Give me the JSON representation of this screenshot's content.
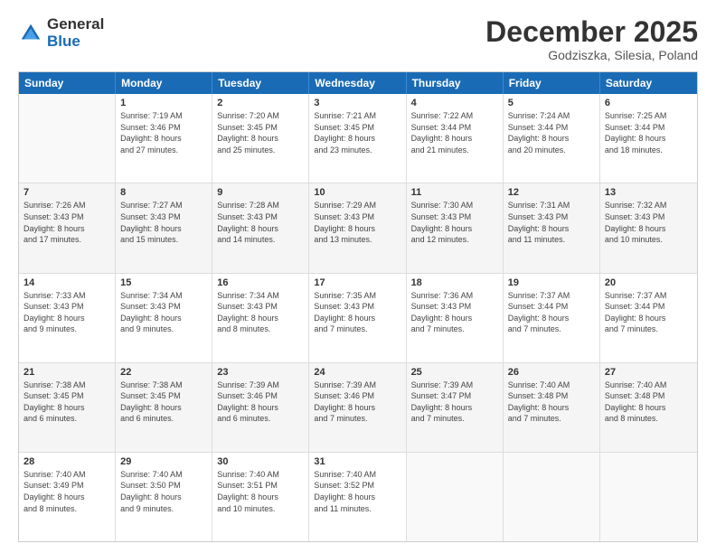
{
  "logo": {
    "general": "General",
    "blue": "Blue"
  },
  "header": {
    "month": "December 2025",
    "location": "Godziszka, Silesia, Poland"
  },
  "weekdays": [
    "Sunday",
    "Monday",
    "Tuesday",
    "Wednesday",
    "Thursday",
    "Friday",
    "Saturday"
  ],
  "rows": [
    [
      {
        "day": "",
        "info": ""
      },
      {
        "day": "1",
        "info": "Sunrise: 7:19 AM\nSunset: 3:46 PM\nDaylight: 8 hours\nand 27 minutes."
      },
      {
        "day": "2",
        "info": "Sunrise: 7:20 AM\nSunset: 3:45 PM\nDaylight: 8 hours\nand 25 minutes."
      },
      {
        "day": "3",
        "info": "Sunrise: 7:21 AM\nSunset: 3:45 PM\nDaylight: 8 hours\nand 23 minutes."
      },
      {
        "day": "4",
        "info": "Sunrise: 7:22 AM\nSunset: 3:44 PM\nDaylight: 8 hours\nand 21 minutes."
      },
      {
        "day": "5",
        "info": "Sunrise: 7:24 AM\nSunset: 3:44 PM\nDaylight: 8 hours\nand 20 minutes."
      },
      {
        "day": "6",
        "info": "Sunrise: 7:25 AM\nSunset: 3:44 PM\nDaylight: 8 hours\nand 18 minutes."
      }
    ],
    [
      {
        "day": "7",
        "info": "Sunrise: 7:26 AM\nSunset: 3:43 PM\nDaylight: 8 hours\nand 17 minutes."
      },
      {
        "day": "8",
        "info": "Sunrise: 7:27 AM\nSunset: 3:43 PM\nDaylight: 8 hours\nand 15 minutes."
      },
      {
        "day": "9",
        "info": "Sunrise: 7:28 AM\nSunset: 3:43 PM\nDaylight: 8 hours\nand 14 minutes."
      },
      {
        "day": "10",
        "info": "Sunrise: 7:29 AM\nSunset: 3:43 PM\nDaylight: 8 hours\nand 13 minutes."
      },
      {
        "day": "11",
        "info": "Sunrise: 7:30 AM\nSunset: 3:43 PM\nDaylight: 8 hours\nand 12 minutes."
      },
      {
        "day": "12",
        "info": "Sunrise: 7:31 AM\nSunset: 3:43 PM\nDaylight: 8 hours\nand 11 minutes."
      },
      {
        "day": "13",
        "info": "Sunrise: 7:32 AM\nSunset: 3:43 PM\nDaylight: 8 hours\nand 10 minutes."
      }
    ],
    [
      {
        "day": "14",
        "info": "Sunrise: 7:33 AM\nSunset: 3:43 PM\nDaylight: 8 hours\nand 9 minutes."
      },
      {
        "day": "15",
        "info": "Sunrise: 7:34 AM\nSunset: 3:43 PM\nDaylight: 8 hours\nand 9 minutes."
      },
      {
        "day": "16",
        "info": "Sunrise: 7:34 AM\nSunset: 3:43 PM\nDaylight: 8 hours\nand 8 minutes."
      },
      {
        "day": "17",
        "info": "Sunrise: 7:35 AM\nSunset: 3:43 PM\nDaylight: 8 hours\nand 7 minutes."
      },
      {
        "day": "18",
        "info": "Sunrise: 7:36 AM\nSunset: 3:43 PM\nDaylight: 8 hours\nand 7 minutes."
      },
      {
        "day": "19",
        "info": "Sunrise: 7:37 AM\nSunset: 3:44 PM\nDaylight: 8 hours\nand 7 minutes."
      },
      {
        "day": "20",
        "info": "Sunrise: 7:37 AM\nSunset: 3:44 PM\nDaylight: 8 hours\nand 7 minutes."
      }
    ],
    [
      {
        "day": "21",
        "info": "Sunrise: 7:38 AM\nSunset: 3:45 PM\nDaylight: 8 hours\nand 6 minutes."
      },
      {
        "day": "22",
        "info": "Sunrise: 7:38 AM\nSunset: 3:45 PM\nDaylight: 8 hours\nand 6 minutes."
      },
      {
        "day": "23",
        "info": "Sunrise: 7:39 AM\nSunset: 3:46 PM\nDaylight: 8 hours\nand 6 minutes."
      },
      {
        "day": "24",
        "info": "Sunrise: 7:39 AM\nSunset: 3:46 PM\nDaylight: 8 hours\nand 7 minutes."
      },
      {
        "day": "25",
        "info": "Sunrise: 7:39 AM\nSunset: 3:47 PM\nDaylight: 8 hours\nand 7 minutes."
      },
      {
        "day": "26",
        "info": "Sunrise: 7:40 AM\nSunset: 3:48 PM\nDaylight: 8 hours\nand 7 minutes."
      },
      {
        "day": "27",
        "info": "Sunrise: 7:40 AM\nSunset: 3:48 PM\nDaylight: 8 hours\nand 8 minutes."
      }
    ],
    [
      {
        "day": "28",
        "info": "Sunrise: 7:40 AM\nSunset: 3:49 PM\nDaylight: 8 hours\nand 8 minutes."
      },
      {
        "day": "29",
        "info": "Sunrise: 7:40 AM\nSunset: 3:50 PM\nDaylight: 8 hours\nand 9 minutes."
      },
      {
        "day": "30",
        "info": "Sunrise: 7:40 AM\nSunset: 3:51 PM\nDaylight: 8 hours\nand 10 minutes."
      },
      {
        "day": "31",
        "info": "Sunrise: 7:40 AM\nSunset: 3:52 PM\nDaylight: 8 hours\nand 11 minutes."
      },
      {
        "day": "",
        "info": ""
      },
      {
        "day": "",
        "info": ""
      },
      {
        "day": "",
        "info": ""
      }
    ]
  ]
}
